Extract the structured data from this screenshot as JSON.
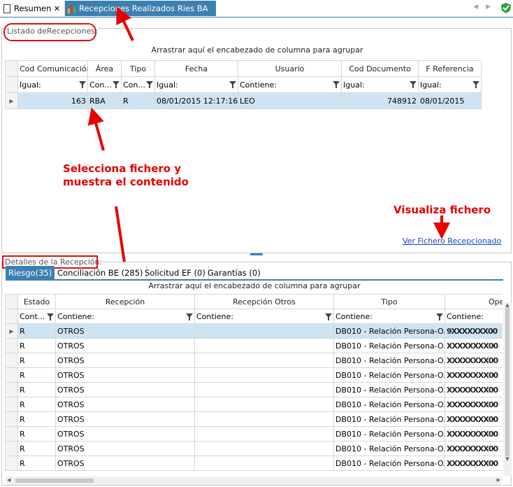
{
  "tabs": [
    {
      "label": "Resumen"
    },
    {
      "label": "Recepciones Realizados Ries BA"
    }
  ],
  "top_panel": {
    "caption": "Listado deRecepciones:",
    "group_hint": "Arrastrar aquí el encabezado de columna para agrupar",
    "columns": [
      "Cod Comunicación",
      "Área",
      "Tipo",
      "Fecha",
      "Usuario",
      "Cod Documento",
      "F Referencia"
    ],
    "filters": [
      "Igual:",
      "Con...",
      "Con...",
      "Igual:",
      "Contiene:",
      "Igual:",
      "Igual:"
    ],
    "rows": [
      [
        "163",
        "RBA",
        "R",
        "08/01/2015 12:17:16",
        "LEO",
        "748912",
        "08/01/2015"
      ]
    ]
  },
  "annotations": {
    "select_text": "Selecciona fichero y muestra el contenido",
    "select_line1": "Selecciona fichero y",
    "select_line2": "muestra el contenido",
    "view_text": "Visualiza fichero",
    "view_link": "Ver Fichero Recepcionado"
  },
  "bottom_panel": {
    "caption": "Detalles de la Recepción:",
    "tabs": [
      "Riesgo(35)",
      "Conciliación BE (285)",
      "Solicitud EF (0)",
      "Garantías (0)"
    ],
    "group_hint": "Arrastrar aquí el encabezado de columna para agrupar",
    "columns": [
      "Estado",
      "Recepción",
      "Recepción Otros",
      "Tipo",
      "Ope"
    ],
    "filters": [
      "Cont...",
      "Contiene:",
      "Contiene:",
      "Contiene:",
      "Contiene:"
    ],
    "rows": [
      [
        "R",
        "OTROS",
        "",
        "DB010 - Relación Persona-O...",
        "9XXXXXXX00"
      ],
      [
        "R",
        "OTROS",
        "",
        "DB010 - Relación Persona-O...",
        "XXXXXXXX00"
      ],
      [
        "R",
        "OTROS",
        "",
        "DB010 - Relación Persona-O...",
        "XXXXXXXX00"
      ],
      [
        "R",
        "OTROS",
        "",
        "DB010 - Relación Persona-O...",
        "XXXXXXXX00"
      ],
      [
        "R",
        "OTROS",
        "",
        "DB010 - Relación Persona-O...",
        "XXXXXXXX00"
      ],
      [
        "R",
        "OTROS",
        "",
        "DB010 - Relación Persona-O...",
        "XXXXXXXX00"
      ],
      [
        "R",
        "OTROS",
        "",
        "DB010 - Relación Persona-O...",
        "XXXXXXXX00"
      ],
      [
        "R",
        "OTROS",
        "",
        "DB010 - Relación Persona-O...",
        "XXXXXXXX00"
      ],
      [
        "R",
        "OTROS",
        "",
        "DB010 - Relación Persona-O...",
        "XXXXXXXX00"
      ],
      [
        "R",
        "OTROS",
        "",
        "DB010 - Relación Persona-O...",
        "XXXXXXXX00"
      ]
    ]
  },
  "colors": {
    "accent": "#3c7fb1",
    "annotation": "#e60000",
    "selected_row": "#cfe4f3"
  }
}
